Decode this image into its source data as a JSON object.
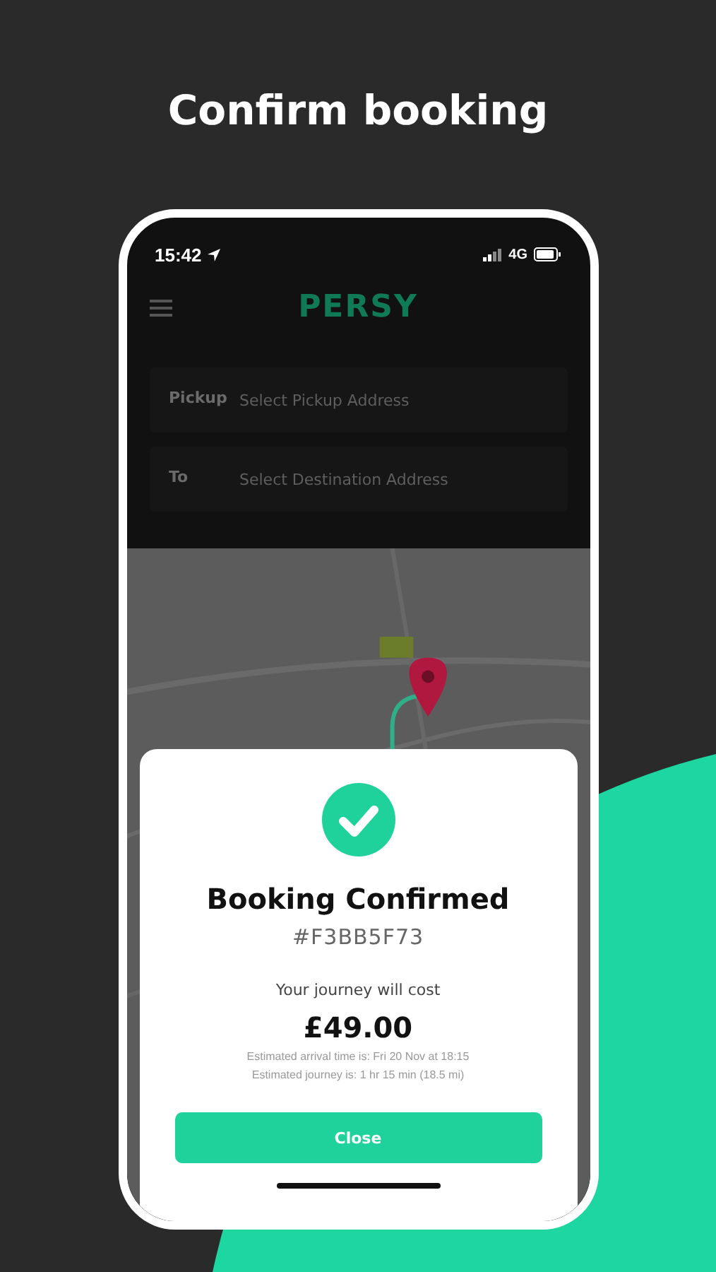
{
  "page_title": "Confirm booking",
  "status_bar": {
    "time": "15:42",
    "network": "4G"
  },
  "app_header": {
    "logo": "PERSY"
  },
  "fields": [
    {
      "label": "Pickup",
      "placeholder": "Select Pickup Address"
    },
    {
      "label": "To",
      "placeholder": "Select Destination Address"
    }
  ],
  "dialog": {
    "title": "Booking Confirmed",
    "reference": "#F3BB5F73",
    "cost_label": "Your journey will cost",
    "price": "£49.00",
    "details": [
      "Estimated arrival time is: Fri 20 Nov at 18:15",
      "Estimated journey is: 1 hr 15 min (18.5 mi)"
    ],
    "button": "Close"
  }
}
